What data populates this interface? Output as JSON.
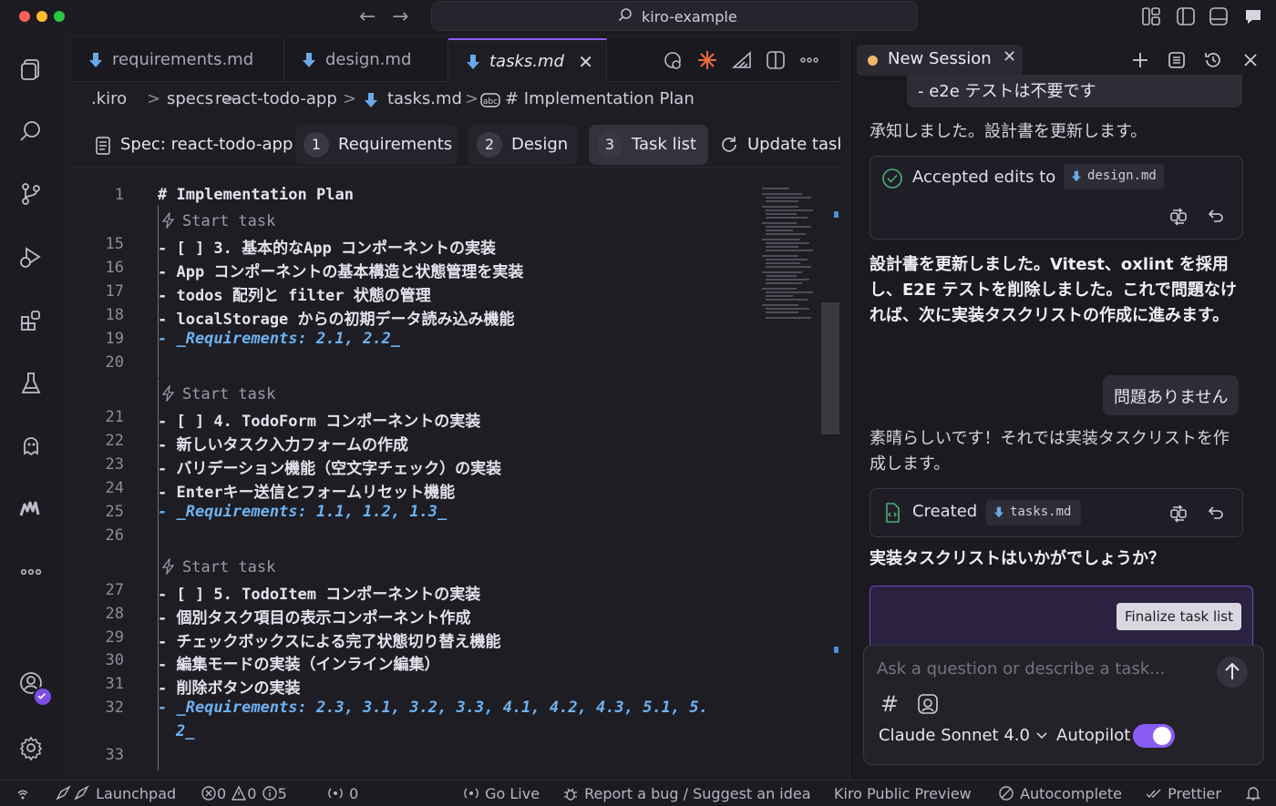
{
  "window": {
    "title": "kiro-example"
  },
  "editor": {
    "tabs": [
      {
        "label": "requirements.md",
        "active": false
      },
      {
        "label": "design.md",
        "active": false
      },
      {
        "label": "tasks.md",
        "active": true
      }
    ],
    "close_glyph": "✕",
    "breadcrumb": [
      ".kiro",
      ">",
      "specs",
      ">",
      "react-todo-app",
      ">",
      "tasks.md",
      ">",
      "# Implementation Plan"
    ],
    "spec_bar": {
      "spec_label": "Spec: react-todo-app",
      "steps": [
        {
          "num": "1",
          "label": "Requirements"
        },
        {
          "num": "2",
          "label": "Design"
        },
        {
          "num": "3",
          "label": "Task list",
          "active": true
        }
      ],
      "update_label": "Update tasks"
    },
    "code": {
      "start_task_label": "Start task",
      "lines": [
        {
          "num": "1",
          "text": "# Implementation Plan"
        },
        {
          "num": "15",
          "text": "- [ ] 3. 基本的なApp コンポーネントの実装"
        },
        {
          "num": "16",
          "text": "  - App コンポーネントの基本構造と状態管理を実装"
        },
        {
          "num": "17",
          "text": "  - todos 配列と filter 状態の管理"
        },
        {
          "num": "18",
          "text": "  - localStorage からの初期データ読み込み機能"
        },
        {
          "num": "19",
          "text": "  - _Requirements: 2.1, 2.2_"
        },
        {
          "num": "20",
          "text": ""
        },
        {
          "num": "21",
          "text": "- [ ] 4. TodoForm コンポーネントの実装"
        },
        {
          "num": "22",
          "text": "  - 新しいタスク入力フォームの作成"
        },
        {
          "num": "23",
          "text": "  - バリデーション機能（空文字チェック）の実装"
        },
        {
          "num": "24",
          "text": "  - Enterキー送信とフォームリセット機能"
        },
        {
          "num": "25",
          "text": "  - _Requirements: 1.1, 1.2, 1.3_"
        },
        {
          "num": "26",
          "text": ""
        },
        {
          "num": "27",
          "text": "- [ ] 5. TodoItem コンポーネントの実装"
        },
        {
          "num": "28",
          "text": "  - 個別タスク項目の表示コンポーネント作成"
        },
        {
          "num": "29",
          "text": "  - チェックボックスによる完了状態切り替え機能"
        },
        {
          "num": "30",
          "text": "  - 編集モードの実装（インライン編集）"
        },
        {
          "num": "31",
          "text": "  - 削除ボタンの実装"
        },
        {
          "num": "32",
          "text": "  - _Requirements: 2.3, 3.1, 3.2, 3.3, 4.1, 4.2, 4.3, 5.1, 5."
        },
        {
          "num": "",
          "text": "2_"
        },
        {
          "num": "33",
          "text": ""
        }
      ]
    }
  },
  "chat": {
    "session_label": "New Session",
    "messages": {
      "user_top": "- e2e テストは不要です",
      "ack": "承知しました。設計書を更新します。",
      "accepted_label": "Accepted edits to",
      "accepted_file": "design.md",
      "updated": "設計書を更新しました。Vitest、oxlint を採用し、E2E テストを削除しました。これで問題なければ、次に実装タスクリストの作成に進みます。",
      "user_ok": "問題ありません",
      "great": "素晴らしいです！それでは実装タスクリストを作成します。",
      "created_label": "Created",
      "created_file": "tasks.md",
      "question": "実装タスクリストはいかがでしょうか？"
    },
    "finalize_label": "Finalize task list",
    "composer": {
      "placeholder": "Ask a question or describe a task...",
      "hash": "#",
      "model": "Claude Sonnet 4.0",
      "autopilot_label": "Autopilot",
      "autopilot_on": true
    }
  },
  "statusbar": {
    "launchpad": "Launchpad",
    "errors": "0",
    "warnings": "0",
    "infos": "5",
    "ports": "0",
    "go_live": "Go Live",
    "report": "Report a bug / Suggest an idea",
    "preview": "Kiro Public Preview",
    "autocomplete": "Autocomplete",
    "prettier": "Prettier"
  },
  "colors": {
    "accent": "#8a5cf6",
    "link": "#6db3f2",
    "session_dot": "#f0b76b"
  }
}
